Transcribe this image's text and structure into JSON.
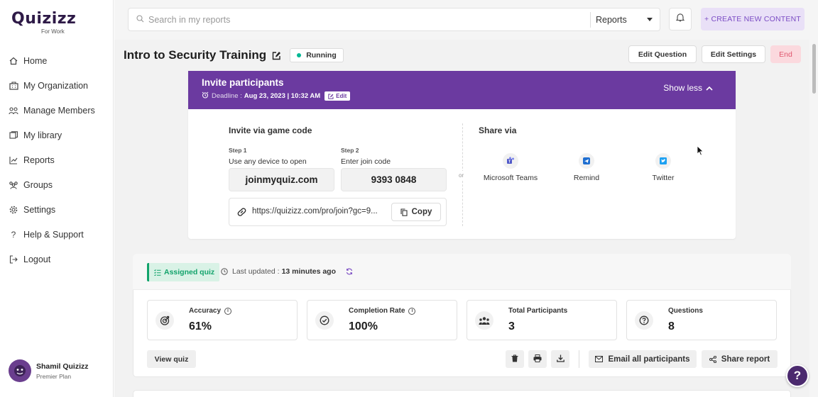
{
  "brand": {
    "name": "Quizizz",
    "sub": "For Work"
  },
  "sidebar": {
    "items": [
      {
        "label": "Home",
        "icon": "home-icon"
      },
      {
        "label": "My Organization",
        "icon": "organization-icon"
      },
      {
        "label": "Manage Members",
        "icon": "members-icon"
      },
      {
        "label": "My library",
        "icon": "library-icon"
      },
      {
        "label": "Reports",
        "icon": "reports-icon"
      },
      {
        "label": "Groups",
        "icon": "groups-icon"
      },
      {
        "label": "Settings",
        "icon": "gear-icon"
      },
      {
        "label": "Help & Support",
        "icon": "help-icon"
      },
      {
        "label": "Logout",
        "icon": "logout-icon"
      }
    ],
    "user": {
      "name": "Shamil Quizizz",
      "plan": "Premier Plan"
    }
  },
  "topbar": {
    "search_placeholder": "Search in my reports",
    "search_scope": "Reports",
    "create_label": "+  CREATE NEW CONTENT"
  },
  "header": {
    "title": "Intro to Security Training",
    "status": "Running",
    "edit_question": "Edit Question",
    "edit_settings": "Edit Settings",
    "end": "End"
  },
  "invite": {
    "title": "Invite participants",
    "deadline_label": "Deadline :",
    "deadline_value": "Aug 23, 2023 | 10:32 AM",
    "edit_label": "Edit",
    "toggle_label": "Show less",
    "game_code_title": "Invite via game code",
    "step1_label": "Step 1",
    "step1_desc": "Use any device to open",
    "step1_value": "joinmyquiz.com",
    "step2_label": "Step 2",
    "step2_desc": "Enter join code",
    "step2_value": "9393 0848",
    "link": "https://quizizz.com/pro/join?gc=9...",
    "copy_label": "Copy",
    "or_label": "or",
    "share_title": "Share via",
    "share_options": [
      {
        "label": "Microsoft Teams",
        "icon": "teams-icon"
      },
      {
        "label": "Remind",
        "icon": "remind-icon"
      },
      {
        "label": "Twitter",
        "icon": "twitter-icon"
      }
    ]
  },
  "report": {
    "tag": "Assigned quiz",
    "updated_label": "Last updated :",
    "updated_value": "13 minutes ago",
    "stats": [
      {
        "label": "Accuracy",
        "value": "61%",
        "icon": "target-icon",
        "info": true
      },
      {
        "label": "Completion Rate",
        "value": "100%",
        "icon": "check-circle-icon",
        "info": true
      },
      {
        "label": "Total Participants",
        "value": "3",
        "icon": "participants-icon",
        "info": false
      },
      {
        "label": "Questions",
        "value": "8",
        "icon": "question-icon",
        "info": false
      }
    ],
    "view_quiz": "View quiz",
    "email_all": "Email all participants",
    "share_report": "Share report"
  },
  "help_fab": "?",
  "colors": {
    "brand_purple": "#6b3aa0",
    "running_green": "#00b894",
    "assigned_green": "#12a36b",
    "end_red": "#e0566e"
  }
}
